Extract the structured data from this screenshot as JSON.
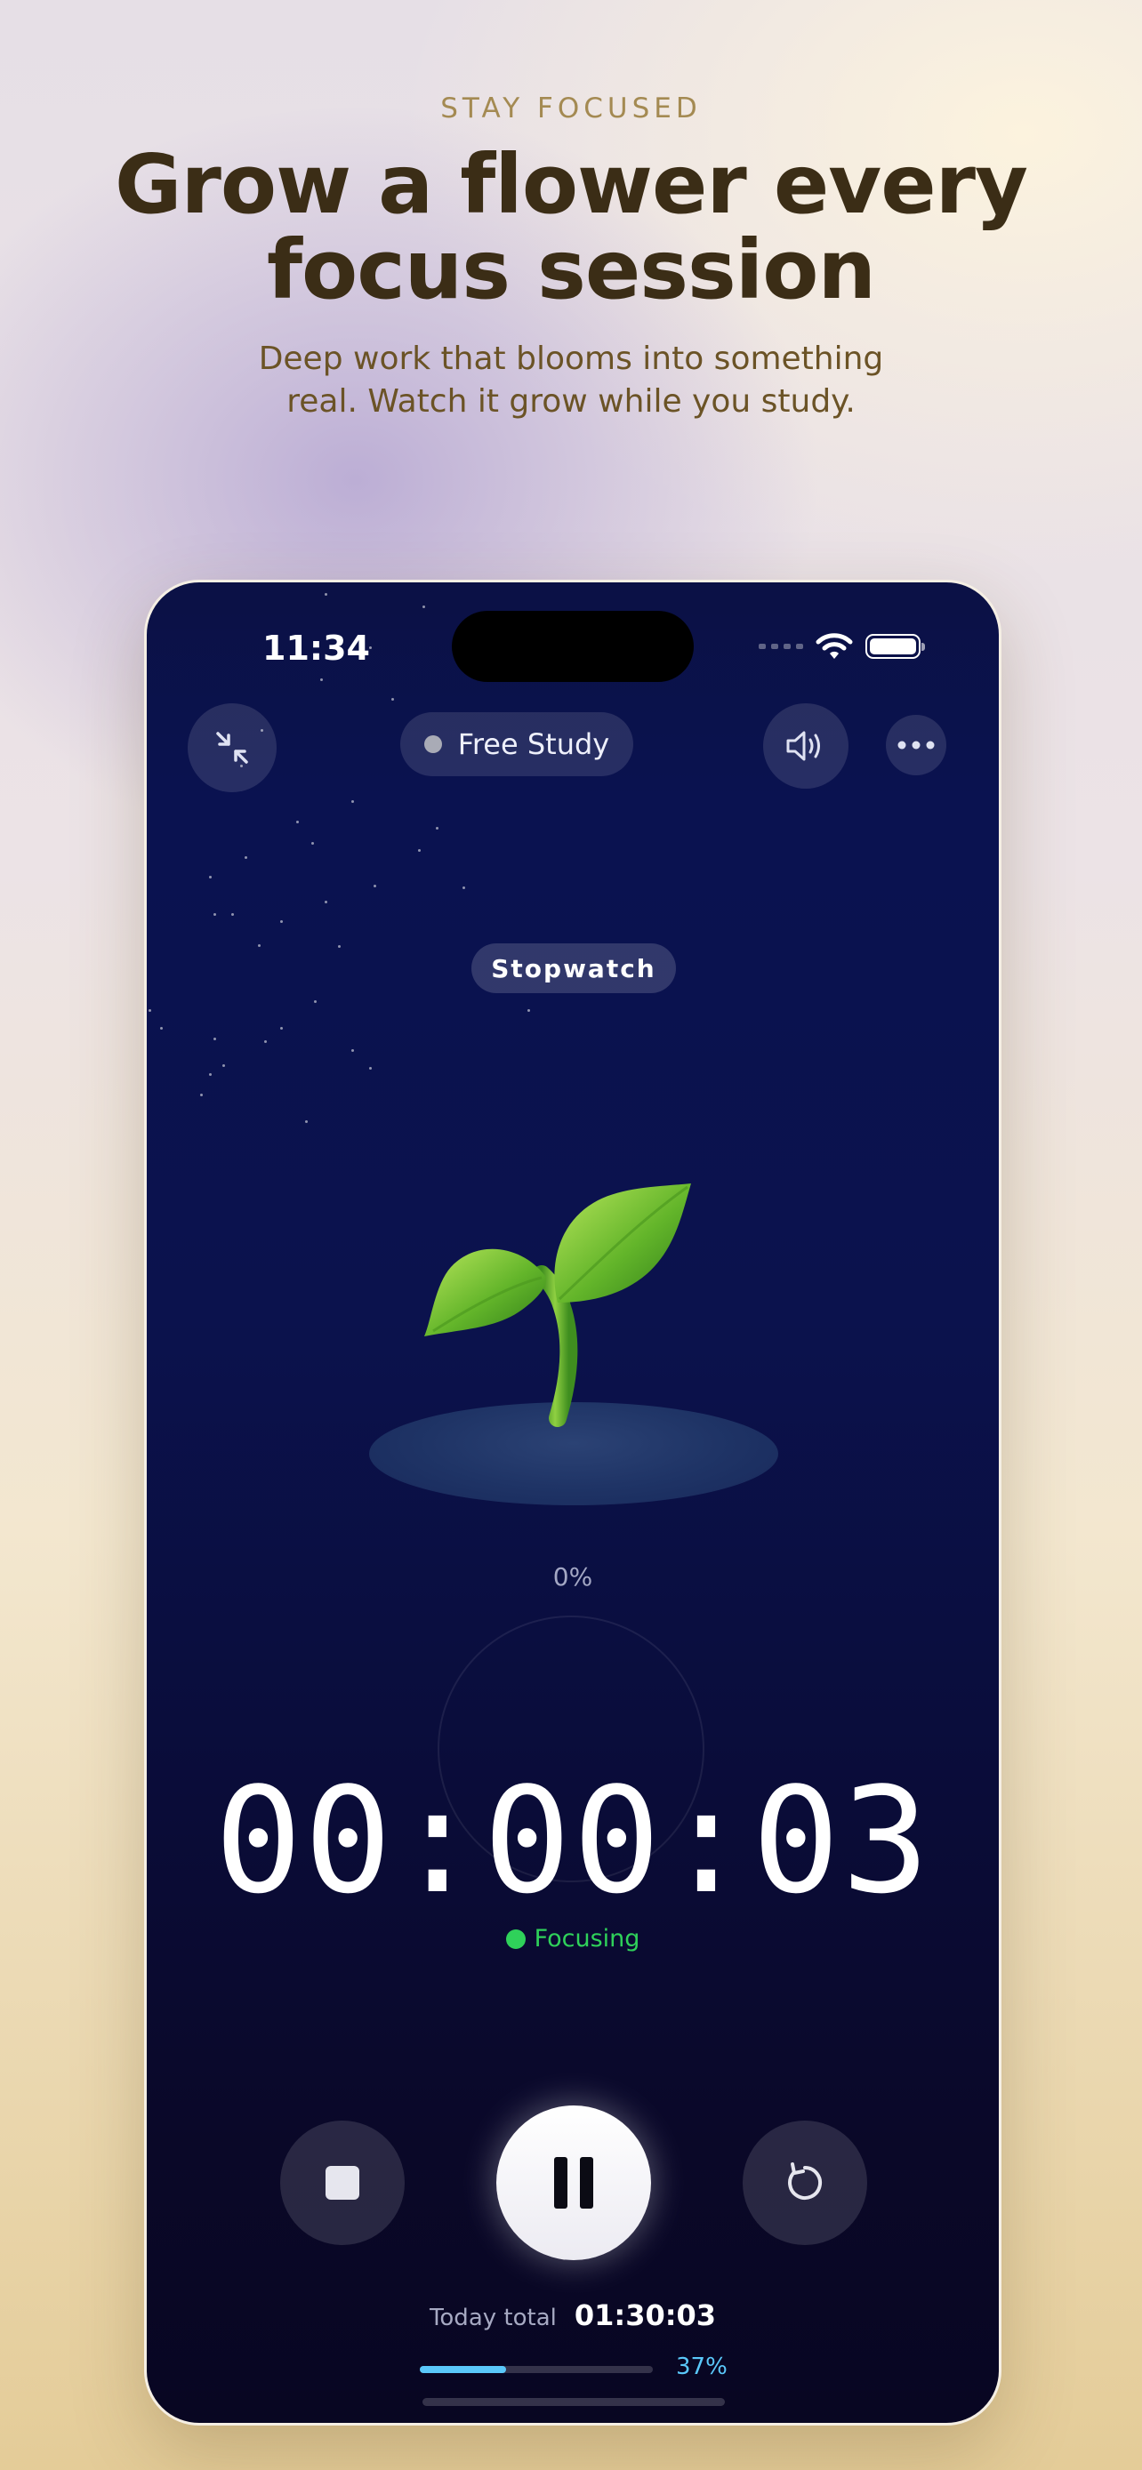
{
  "hero": {
    "eyebrow": "STAY FOCUSED",
    "headline_line1": "Grow a flower every",
    "headline_line2": "focus session",
    "subtitle_line1": "Deep work that blooms into something",
    "subtitle_line2": "real. Watch it grow while you study."
  },
  "status_bar": {
    "time": "11:34"
  },
  "top_bar": {
    "collapse_icon": "collapse-arrows-icon",
    "mode_label": "Free Study",
    "sound_icon": "speaker-icon",
    "more_icon": "ellipsis-icon"
  },
  "timer_mode": "Stopwatch",
  "plant": {
    "emoji": "🌱",
    "growth_label": "0%"
  },
  "timer": {
    "display": "00:00:03",
    "state": "Focusing"
  },
  "controls": {
    "stop_icon": "stop-icon",
    "pause_icon": "pause-icon",
    "reset_icon": "reset-icon"
  },
  "today": {
    "label": "Today total",
    "value": "01:30:03",
    "progress_percent": 37,
    "progress_label": "37%"
  },
  "colors": {
    "accent_green": "#2fd15a",
    "accent_blue": "#5ac8fa",
    "headline": "#3b2d16",
    "eyebrow": "#a48a52"
  }
}
